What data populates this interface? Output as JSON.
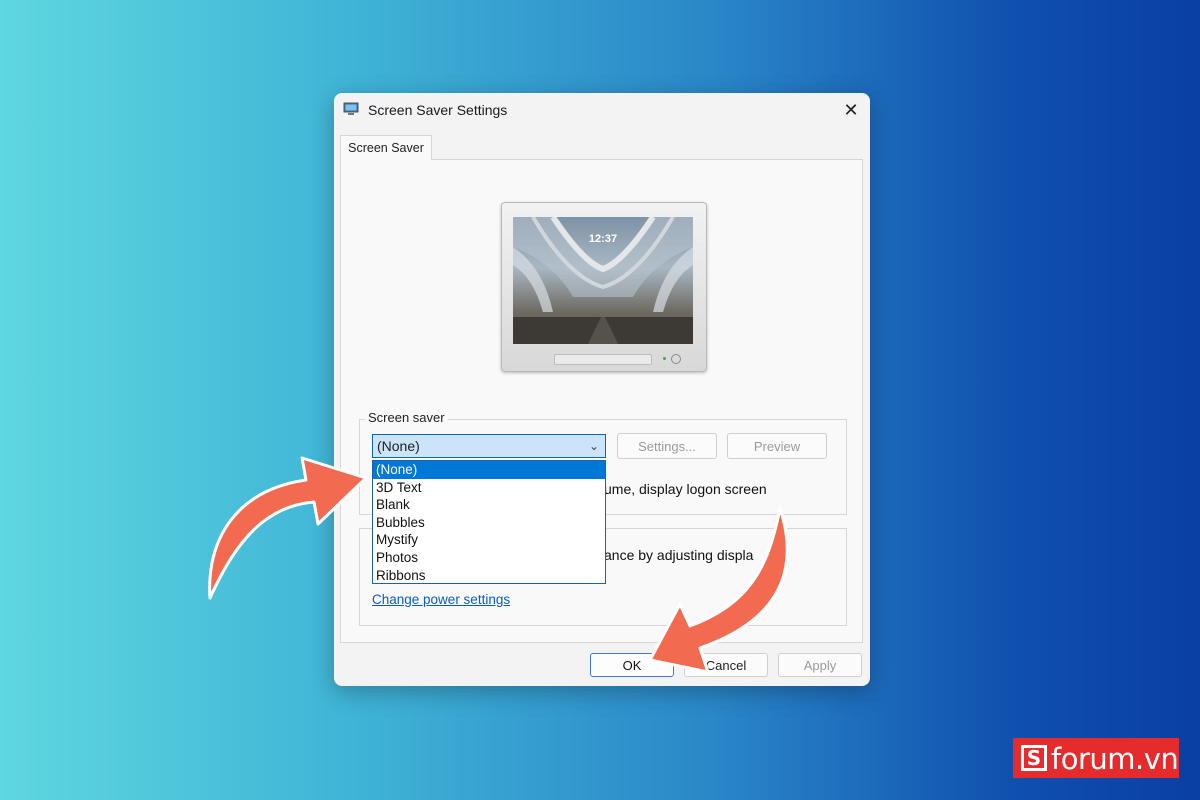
{
  "window": {
    "title": "Screen Saver Settings",
    "close_label": "✕"
  },
  "tabs": [
    {
      "label": "Screen Saver"
    }
  ],
  "preview_screen": {
    "time": "12:37"
  },
  "screen_saver_group": {
    "label": "Screen saver",
    "selected": "(None)",
    "settings_button": "Settings...",
    "preview_button": "Preview",
    "logon_text_visible_part": "ume, display logon screen"
  },
  "dropdown": {
    "options": [
      "(None)",
      "3D Text",
      "Blank",
      "Bubbles",
      "Mystify",
      "Photos",
      "Ribbons"
    ],
    "selected_index": 0
  },
  "power_group": {
    "text_visible_part": "ance by adjusting displa",
    "link": "Change power settings"
  },
  "footer": {
    "ok": "OK",
    "cancel": "Cancel",
    "apply": "Apply"
  },
  "watermark": {
    "brand": "forum.vn",
    "logo_letter": "S"
  },
  "colors": {
    "accent": "#0078d7",
    "arrow": "#f26a4f",
    "brand_red": "#e52b2b"
  }
}
